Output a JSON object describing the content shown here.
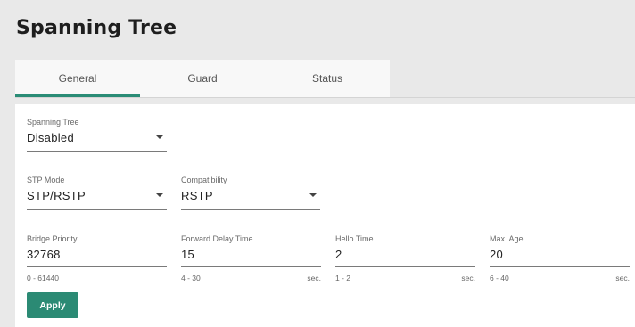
{
  "page": {
    "title": "Spanning Tree"
  },
  "tabs": [
    {
      "label": "General",
      "active": true
    },
    {
      "label": "Guard",
      "active": false
    },
    {
      "label": "Status",
      "active": false
    }
  ],
  "form": {
    "spanning_tree": {
      "label": "Spanning Tree",
      "value": "Disabled"
    },
    "stp_mode": {
      "label": "STP Mode",
      "value": "STP/RSTP"
    },
    "compatibility": {
      "label": "Compatibility",
      "value": "RSTP"
    },
    "bridge_priority": {
      "label": "Bridge Priority",
      "value": "32768",
      "hint": "0 - 61440"
    },
    "forward_delay": {
      "label": "Forward Delay Time",
      "value": "15",
      "hint": "4 - 30",
      "unit": "sec."
    },
    "hello_time": {
      "label": "Hello Time",
      "value": "2",
      "hint": "1 - 2",
      "unit": "sec."
    },
    "max_age": {
      "label": "Max. Age",
      "value": "20",
      "hint": "6 - 40",
      "unit": "sec."
    }
  },
  "actions": {
    "apply_label": "Apply"
  },
  "colors": {
    "accent": "#2b8a74",
    "tab_indicator": "#2a8c76",
    "background": "#e9e9e9"
  },
  "icons": {
    "dropdown": "caret-down-icon"
  }
}
